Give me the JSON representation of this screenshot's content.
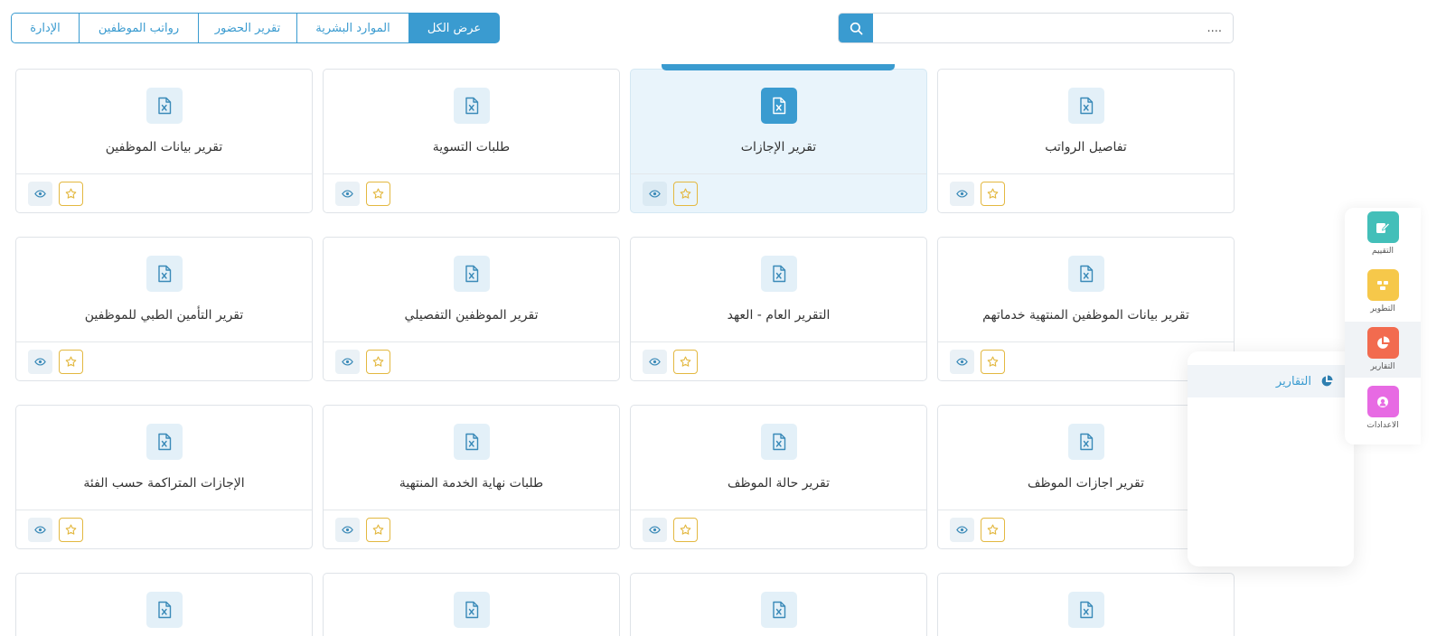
{
  "filters": {
    "all": "عرض الكل",
    "hr": "الموارد البشرية",
    "attendance": "تقرير الحضور",
    "payroll": "رواتب الموظفين",
    "admin": "الإدارة",
    "active": "all"
  },
  "search": {
    "placeholder": "...."
  },
  "reports": [
    {
      "title": "تفاصيل الرواتب"
    },
    {
      "title": "تقرير الإجازات",
      "selected": true
    },
    {
      "title": "طلبات التسوية"
    },
    {
      "title": "تقرير بيانات الموظفين"
    },
    {
      "title": "تقرير بيانات الموظفين المنتهية خدماتهم"
    },
    {
      "title": "التقرير العام - العهد"
    },
    {
      "title": "تقرير الموظفين التفصيلي"
    },
    {
      "title": "تقرير التأمين الطبي للموظفين"
    },
    {
      "title": "تقرير اجازات الموظف"
    },
    {
      "title": "تقرير حالة الموظف"
    },
    {
      "title": "طلبات نهاية الخدمة المنتهية"
    },
    {
      "title": "الإجازات المتراكمة حسب الفئة"
    }
  ],
  "rail": {
    "evaluation": {
      "label": "التقييم",
      "color": "#43bfb9",
      "icon": "edit-icon"
    },
    "development": {
      "label": "التطوير",
      "color": "#f6c84a",
      "icon": "development-icon"
    },
    "reports": {
      "label": "التقارير",
      "color": "#f26b4f",
      "icon": "pie-chart-icon",
      "active": true
    },
    "settings": {
      "label": "الاعدادات",
      "color": "#e76ae3",
      "icon": "settings-icon"
    }
  },
  "popover": {
    "item_label": "التقارير",
    "icon": "pie-chart-icon"
  },
  "colors": {
    "accent": "#3a9bd0",
    "star": "#e3b840"
  }
}
